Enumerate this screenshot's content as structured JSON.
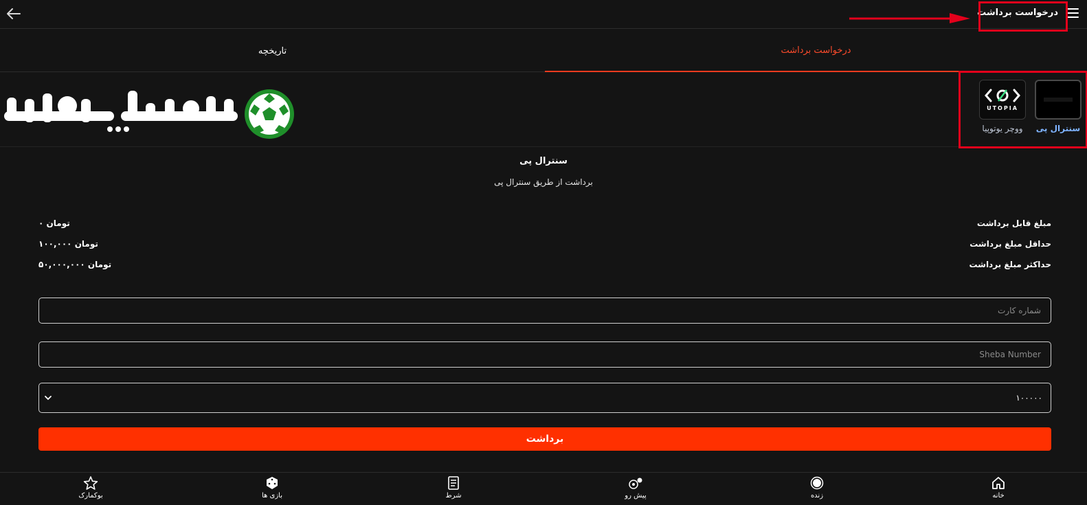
{
  "header": {
    "title": "درخواست برداشت"
  },
  "tabs": [
    {
      "label": "درخواست برداشت",
      "active": true
    },
    {
      "label": "تاریخچه",
      "active": false
    }
  ],
  "brand": {
    "logo_text": "اسپورت شرط"
  },
  "methods": [
    {
      "label": "سنترال پی",
      "selected": true,
      "icon": "central-pay-logo"
    },
    {
      "label": "ووچر یوتوپیا",
      "selected": false,
      "icon": "utopia-logo",
      "logo_text": "UTOPIA"
    }
  ],
  "selected_method": {
    "title": "سنترال پی",
    "description": "برداشت از طریق سنترال پی"
  },
  "limits": [
    {
      "label": "مبلغ قابل برداشت",
      "value": "۰ تومان"
    },
    {
      "label": "حداقل مبلغ برداشت",
      "value": "۱۰۰,۰۰۰ تومان"
    },
    {
      "label": "حداکثر مبلغ برداشت",
      "value": "۵۰,۰۰۰,۰۰۰ تومان"
    }
  ],
  "form": {
    "card_placeholder": "شماره کارت",
    "sheba_placeholder": "Sheba Number",
    "amount_selected": "۱۰۰۰۰۰",
    "submit_label": "برداشت"
  },
  "bottom_nav": [
    {
      "label": "خانه",
      "icon": "home-icon"
    },
    {
      "label": "زنده",
      "icon": "live-icon"
    },
    {
      "label": "پیش رو",
      "icon": "upcoming-icon"
    },
    {
      "label": "شرط",
      "icon": "betslip-icon"
    },
    {
      "label": "بازی ها",
      "icon": "games-icon"
    },
    {
      "label": "بوکمارک",
      "icon": "bookmark-icon"
    }
  ],
  "colors": {
    "background": "#141414",
    "accent": "#ff3000",
    "active_tab": "#ff4b2b",
    "annotation": "#e3001b"
  }
}
